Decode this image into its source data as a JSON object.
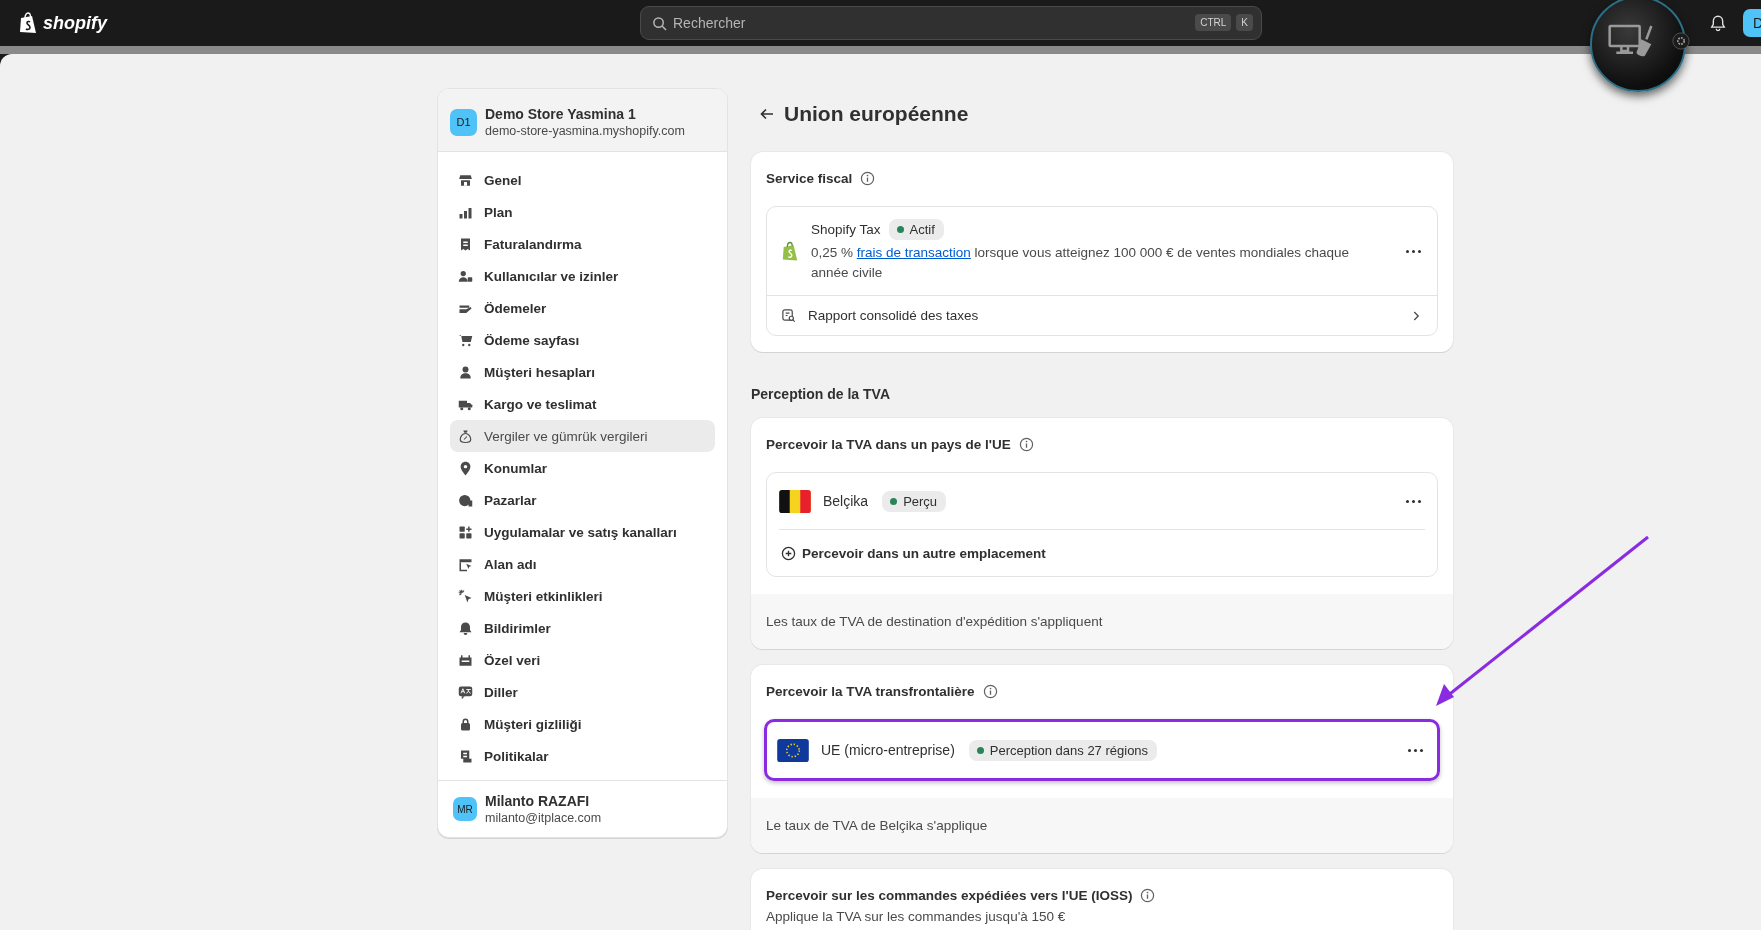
{
  "topbar": {
    "logo": "shopify",
    "search": {
      "placeholder": "Rechercher"
    },
    "shortcut": [
      "CTRL",
      "K"
    ],
    "avatar": "D"
  },
  "sidebar": {
    "store": {
      "initials": "D1",
      "name": "Demo Store Yasmina 1",
      "domain": "demo-store-yasmina.myshopify.com"
    },
    "items": [
      {
        "label": "Genel",
        "selected": false
      },
      {
        "label": "Plan",
        "selected": false
      },
      {
        "label": "Faturalandırma",
        "selected": false
      },
      {
        "label": "Kullanıcılar ve izinler",
        "selected": false
      },
      {
        "label": "Ödemeler",
        "selected": false
      },
      {
        "label": "Ödeme sayfası",
        "selected": false
      },
      {
        "label": "Müşteri hesapları",
        "selected": false
      },
      {
        "label": "Kargo ve teslimat",
        "selected": false
      },
      {
        "label": "Vergiler ve gümrük vergileri",
        "selected": true
      },
      {
        "label": "Konumlar",
        "selected": false
      },
      {
        "label": "Pazarlar",
        "selected": false
      },
      {
        "label": "Uygulamalar ve satış kanalları",
        "selected": false
      },
      {
        "label": "Alan adı",
        "selected": false
      },
      {
        "label": "Müşteri etkinlikleri",
        "selected": false
      },
      {
        "label": "Bildirimler",
        "selected": false
      },
      {
        "label": "Özel veri",
        "selected": false
      },
      {
        "label": "Diller",
        "selected": false
      },
      {
        "label": "Müşteri gizliliği",
        "selected": false
      },
      {
        "label": "Politikalar",
        "selected": false
      }
    ],
    "user": {
      "initials": "MR",
      "name": "Milanto RAZAFI",
      "email": "milanto@itplace.com"
    }
  },
  "page": {
    "title": "Union européenne"
  },
  "tax_service": {
    "title": "Service fiscal",
    "provider": "Shopify Tax",
    "badge": "Actif",
    "description_start": "0,25 %",
    "link": "frais de transaction",
    "description_end": "lorsque vous atteignez 100 000 € de ventes mondiales chaque année civile",
    "report": "Rapport consolidé des taxes"
  },
  "vat_heading": "Perception de la TVA",
  "vat_cards": [
    {
      "title": "Percevoir la TVA dans un pays de l'UE",
      "rows": [
        {
          "kind": "country",
          "name": "Belçika",
          "badge": "Perçu",
          "highlighted": false
        }
      ],
      "add_action": "Percevoir dans un autre emplacement",
      "footer": "Les taux de TVA de destination d'expédition s'appliquent"
    },
    {
      "title": "Percevoir la TVA transfrontalière",
      "rows": [
        {
          "kind": "region",
          "name": "UE (micro-entreprise)",
          "badge": "Perception dans 27 régions",
          "highlighted": true
        }
      ],
      "footer": "Le taux de TVA de Belçika s'applique"
    },
    {
      "title": "Percevoir sur les commandes expédiées vers l'UE (IOSS)",
      "subtitle": "Applique la TVA sur les commandes jusqu'à 150 €"
    }
  ]
}
